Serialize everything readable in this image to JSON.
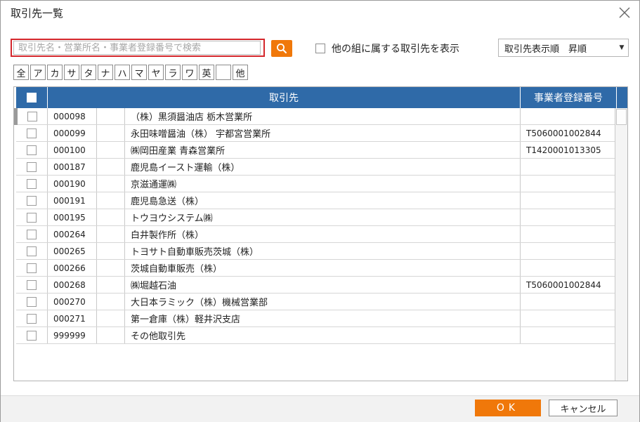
{
  "window": {
    "title": "取引先一覧"
  },
  "search": {
    "placeholder": "取引先名・営業所名・事業者登録番号で検索",
    "value": ""
  },
  "filter": {
    "show_other_groups_label": "他の組に属する取引先を表示",
    "checked": false
  },
  "sort": {
    "selected": "取引先表示順　昇順"
  },
  "kana_buttons": [
    "全",
    "ア",
    "カ",
    "サ",
    "タ",
    "ナ",
    "ハ",
    "マ",
    "ヤ",
    "ラ",
    "ワ",
    "英",
    "",
    "他"
  ],
  "table": {
    "columns": {
      "name": "取引先",
      "registration": "事業者登録番号"
    },
    "rows": [
      {
        "code": "000098",
        "name": "（株）黒須醤油店 栃木営業所",
        "registration": ""
      },
      {
        "code": "000099",
        "name": "永田味噌醤油（株） 宇都宮営業所",
        "registration": "T5060001002844"
      },
      {
        "code": "000100",
        "name": "㈱岡田産業 青森営業所",
        "registration": "T1420001013305"
      },
      {
        "code": "000187",
        "name": "鹿児島イースト運輸（株）",
        "registration": ""
      },
      {
        "code": "000190",
        "name": "京滋通運㈱",
        "registration": ""
      },
      {
        "code": "000191",
        "name": "鹿児島急送（株）",
        "registration": ""
      },
      {
        "code": "000195",
        "name": "トウヨウシステム㈱",
        "registration": ""
      },
      {
        "code": "000264",
        "name": "白井製作所（株）",
        "registration": ""
      },
      {
        "code": "000265",
        "name": "トヨサト自動車販売茨城（株）",
        "registration": ""
      },
      {
        "code": "000266",
        "name": "茨城自動車販売（株）",
        "registration": ""
      },
      {
        "code": "000268",
        "name": "㈱堀越石油",
        "registration": "T5060001002844"
      },
      {
        "code": "000270",
        "name": "大日本ラミック（株）機械営業部",
        "registration": ""
      },
      {
        "code": "000271",
        "name": "第一倉庫（株）軽井沢支店",
        "registration": ""
      },
      {
        "code": "999999",
        "name": "その他取引先",
        "registration": ""
      }
    ]
  },
  "footer": {
    "ok_label": "OK",
    "cancel_label": "キャンセル"
  },
  "colors": {
    "accent": "#f0780a",
    "header": "#2f6aa8",
    "search_highlight": "#d4262b"
  },
  "icons": {
    "search": "search-icon",
    "close": "close-icon",
    "caret": "caret-down-icon"
  }
}
